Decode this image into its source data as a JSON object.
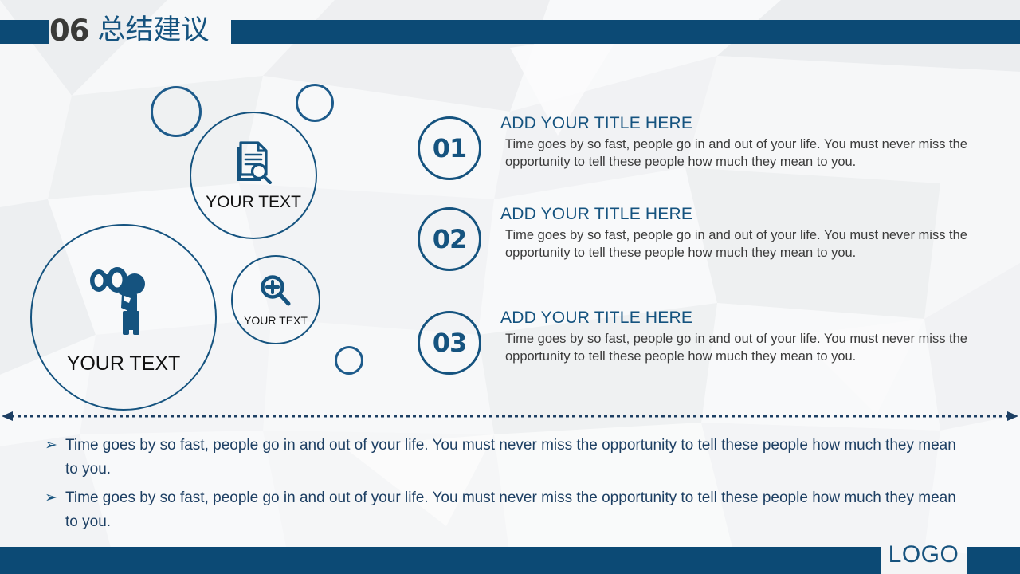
{
  "header": {
    "number": "06",
    "title": "总结建议",
    "bar_color": "#0c4a75",
    "number_color": "#3a3a38",
    "title_color": "#15537f"
  },
  "cluster": {
    "circles": [
      {
        "icon": "document-search-icon",
        "label": "YOUR TEXT"
      },
      {
        "icon": "binoculars-person-icon",
        "label": "YOUR TEXT"
      },
      {
        "icon": "magnifier-plus-icon",
        "label": "YOUR TEXT"
      }
    ],
    "decor_rings": [
      "ring-large",
      "ring-medium",
      "ring-small"
    ],
    "outline_color": "#15537f",
    "icon_color": "#15537f"
  },
  "items": [
    {
      "number": "01",
      "title": "ADD YOUR TITLE HERE",
      "desc": "Time goes by so fast, people go in and out of your life. You must never miss the opportunity to tell these people how much they mean to you."
    },
    {
      "number": "02",
      "title": "ADD YOUR TITLE HERE",
      "desc": "Time goes by so fast, people go in and out of your life. You must never miss the opportunity to tell these people how much they mean to you."
    },
    {
      "number": "03",
      "title": "ADD YOUR TITLE HERE",
      "desc": "Time goes by so fast, people go in and out of your life. You must never miss the opportunity to tell these people how much they mean to you."
    }
  ],
  "divider": {
    "style": "dotted-double-arrow",
    "color": "#1d3f63"
  },
  "bullets": [
    {
      "marker": "➢",
      "text": "Time goes by so fast, people go in and out of your life. You must never miss the opportunity to tell these people how much they mean to you."
    },
    {
      "marker": "➢",
      "text": "Time goes by so fast, people go in and out of your life. You must never miss the opportunity to tell these people how much they mean to you."
    }
  ],
  "footer": {
    "logo": "LOGO",
    "bar_color": "#0c4a75",
    "logo_color": "#17537e"
  }
}
